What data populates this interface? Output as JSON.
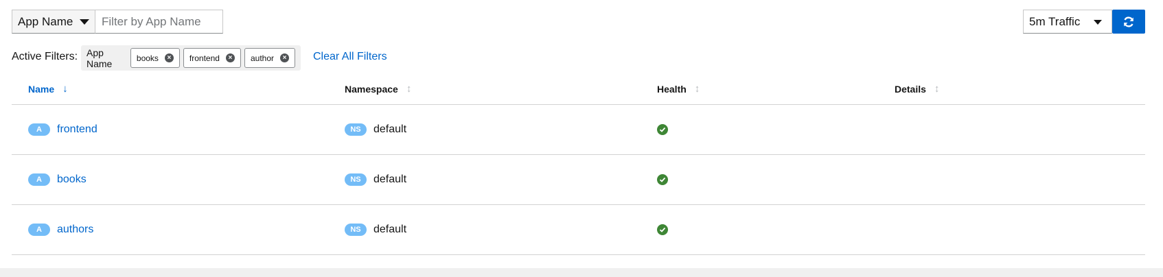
{
  "toolbar": {
    "filter_type": "App Name",
    "filter_placeholder": "Filter by App Name",
    "traffic_select": "5m Traffic"
  },
  "active_filters": {
    "label": "Active Filters:",
    "group_label": "App Name",
    "chips": [
      "books",
      "frontend",
      "author"
    ],
    "clear_all": "Clear All Filters"
  },
  "table": {
    "headers": {
      "name": "Name",
      "namespace": "Namespace",
      "health": "Health",
      "details": "Details"
    },
    "sorted_by": "Name",
    "rows": [
      {
        "badge": "A",
        "name": "frontend",
        "ns_badge": "NS",
        "namespace": "default",
        "health": "healthy"
      },
      {
        "badge": "A",
        "name": "books",
        "ns_badge": "NS",
        "namespace": "default",
        "health": "healthy"
      },
      {
        "badge": "A",
        "name": "authors",
        "ns_badge": "NS",
        "namespace": "default",
        "health": "healthy"
      }
    ]
  },
  "icons": {
    "dropdown": "chevron-down-icon",
    "refresh": "refresh-icon",
    "chip_close": "close-circle-icon",
    "sort": "sort-icon",
    "health": "check-circle-icon"
  },
  "colors": {
    "primary": "#0066cc",
    "badge": "#73bcf7",
    "success": "#3e8635"
  }
}
